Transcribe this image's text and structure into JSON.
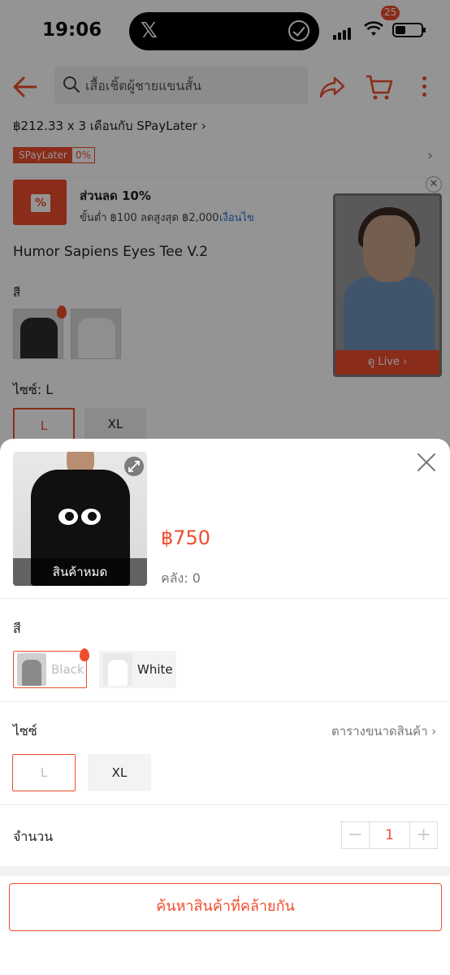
{
  "status_bar": {
    "time": "19:06",
    "island_app_glyph": "𝕏"
  },
  "header": {
    "search_text": "เสื้อเชิ้ตผู้ชายแขนสั้น",
    "cart_count": "25"
  },
  "product": {
    "paylater_line": "฿212.33 x 3 เดือนกับ SPayLater ›",
    "spaylater_badge": "SPayLater",
    "spaylater_rate": "0%",
    "voucher_title": "ส่วนลด 10%",
    "voucher_sub": "ขั้นต่ำ ฿100 ลดสูงสุด ฿2,000",
    "voucher_condition": "เงื่อนไข",
    "title": "Humor Sapiens Eyes Tee V.2",
    "color_label": "สี",
    "size_label": "ไซซ์: L",
    "sizes": [
      "L",
      "XL"
    ]
  },
  "live": {
    "label": "ดู Live ›"
  },
  "sheet": {
    "price": "฿750",
    "stock": "คลัง: 0",
    "sold_out": "สินค้าหมด",
    "color_label": "สี",
    "colors": [
      "Black",
      "White"
    ],
    "size_label": "ไซซ์",
    "size_guide": "ตารางขนาดสินค้า ›",
    "sizes": [
      "L",
      "XL"
    ],
    "quantity_label": "จำนวน",
    "quantity_minus": "−",
    "quantity_value": "1",
    "quantity_plus": "+",
    "cta": "ค้นหาสินค้าที่คล้ายกัน"
  },
  "colors": {
    "accent": "#ee4d2d",
    "link": "#2b6bd0",
    "scrim": "rgba(0,0,0,0.42)"
  }
}
